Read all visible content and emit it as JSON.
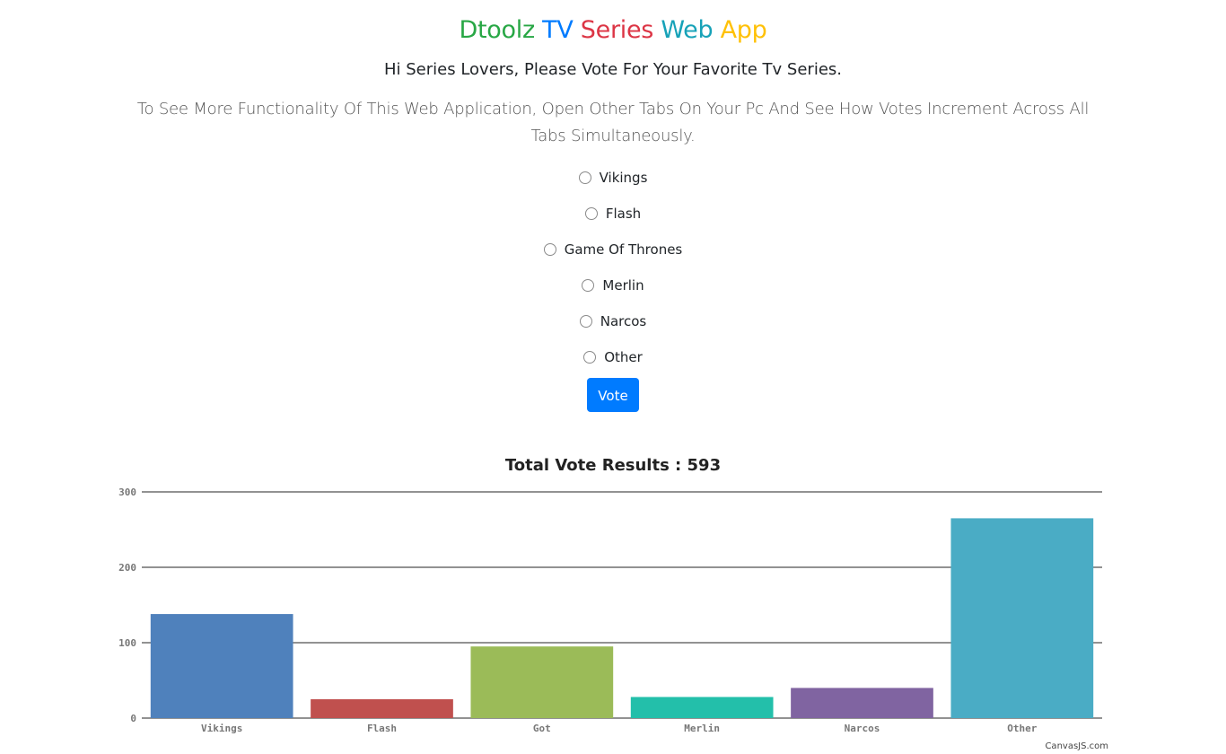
{
  "header": {
    "title_words": [
      {
        "text": "Dtoolz",
        "color": "#28a745"
      },
      {
        "text": "TV",
        "color": "#007bff"
      },
      {
        "text": "Series",
        "color": "#dc3545"
      },
      {
        "text": "Web",
        "color": "#17a2b8"
      },
      {
        "text": "App",
        "color": "#ffc107"
      }
    ],
    "subtitle": "Hi Series Lovers, Please Vote For Your Favorite Tv Series.",
    "lead": "To See More Functionality Of This Web Application, Open Other Tabs On Your Pc And See How Votes Increment Across All Tabs Simultaneously."
  },
  "form": {
    "options": [
      "Vikings",
      "Flash",
      "Game Of Thrones",
      "Merlin",
      "Narcos",
      "Other"
    ],
    "vote_label": "Vote",
    "vote_color": "#007bff"
  },
  "chart_data": {
    "type": "bar",
    "title": "Total Vote Results : 593",
    "categories": [
      "Vikings",
      "Flash",
      "Got",
      "Merlin",
      "Narcos",
      "Other"
    ],
    "values": [
      138,
      25,
      95,
      28,
      40,
      265
    ],
    "colors": [
      "#4f81bc",
      "#c0504e",
      "#9bbb58",
      "#23bfaa",
      "#8064a1",
      "#4aacc5"
    ],
    "ylim": [
      0,
      300
    ],
    "yticks": [
      0,
      100,
      200,
      300
    ],
    "grid": true,
    "xlabel": "",
    "ylabel": ""
  },
  "credit": "CanvasJS.com"
}
